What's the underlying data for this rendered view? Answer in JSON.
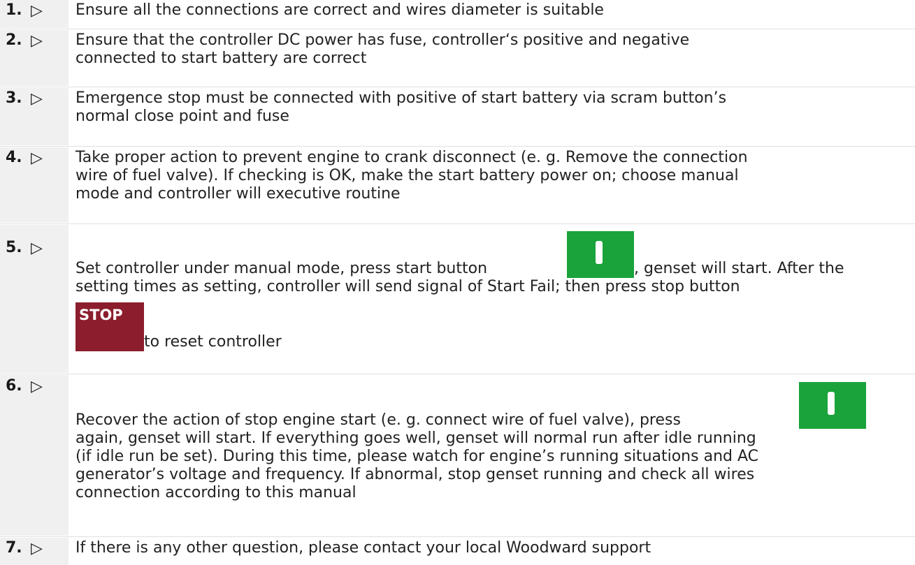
{
  "steps": [
    {
      "num": "1.",
      "arrow": "▷",
      "lines": [
        "Ensure all the connections are correct and wires diameter is suitable"
      ]
    },
    {
      "num": "2.",
      "arrow": "▷",
      "lines": [
        "Ensure that the controller DC power has fuse, controller‘s positive and negative",
        "connected to start battery are correct"
      ]
    },
    {
      "num": "3.",
      "arrow": "▷",
      "lines": [
        "Emergence stop must be connected with positive of start battery via scram button’s",
        "normal close point and fuse"
      ]
    },
    {
      "num": "4.",
      "arrow": "▷",
      "lines": [
        "Take proper action to prevent engine to crank disconnect (e. g. Remove the connection",
        "wire of fuel valve). If checking is OK, make the start battery power on; choose manual",
        "mode and controller will executive routine"
      ]
    },
    {
      "num": "5.",
      "arrow": "▷",
      "line1_before": "Set controller under manual mode, press start button ",
      "line1_after": ", genset will start. After the",
      "line2": "setting times as setting, controller will send signal of Start Fail; then press stop button",
      "stop_label": "STOP",
      "line3": "to reset controller"
    },
    {
      "num": "6.",
      "arrow": "▷",
      "line1": "Recover the action of stop engine start (e. g. connect wire of fuel valve), press",
      "lines": [
        "again, genset will start. If everything goes well, genset will normal run after idle running",
        "(if idle run be set). During this time, please watch for engine’s running situations and AC",
        "generator’s voltage and frequency. If abnormal, stop genset running and check all wires",
        "connection according to this manual"
      ]
    },
    {
      "num": "7.",
      "arrow": "▷",
      "lines": [
        "If there is any other question, please contact your local Woodward support"
      ]
    }
  ],
  "colors": {
    "start_button": "#1aa33a",
    "stop_button": "#8b1d2c",
    "number_column": "#f0f0f0"
  },
  "icons": {
    "start": "start-button-icon",
    "stop": "stop-button-icon"
  }
}
